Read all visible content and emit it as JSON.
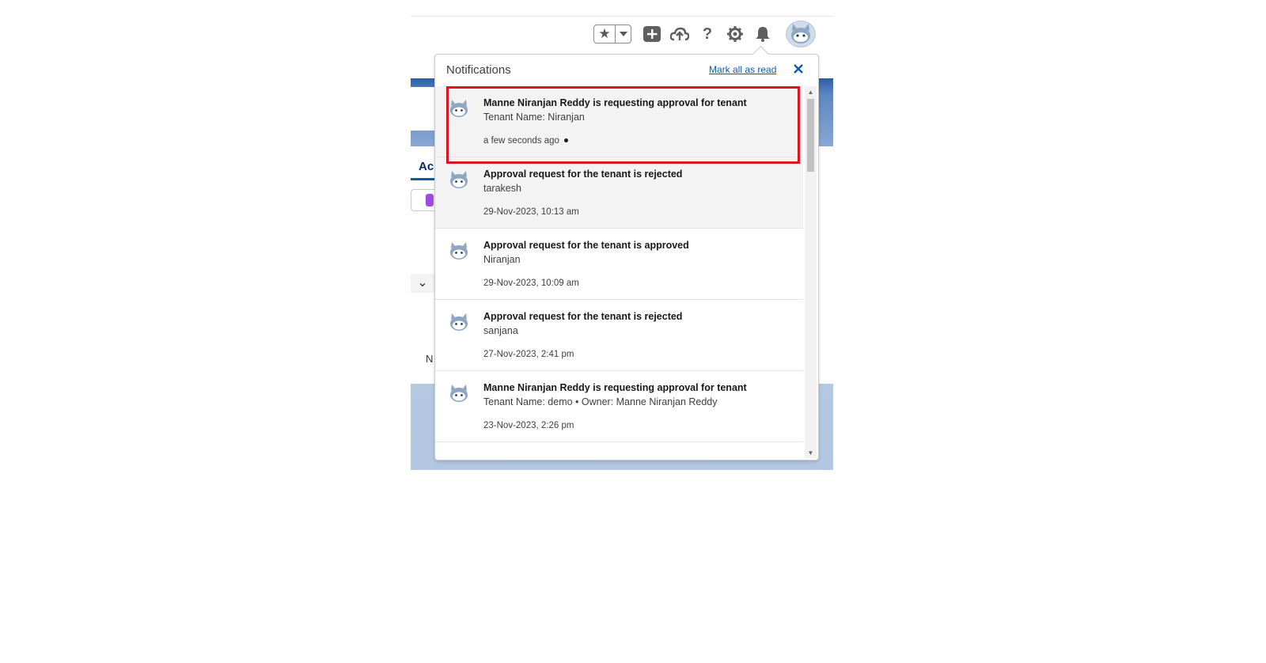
{
  "app": {
    "tab_hint": "Ac",
    "left_hint": "N",
    "chevron": "⌄"
  },
  "header": {
    "icons": [
      "star-icon",
      "chevron-down-icon",
      "add-icon",
      "cloud-upload-icon",
      "help-icon",
      "gear-icon",
      "bell-icon",
      "avatar"
    ]
  },
  "notifications": {
    "title": "Notifications",
    "mark_all_label": "Mark all as read",
    "close_label": "✕",
    "items": [
      {
        "title": "Manne Niranjan Reddy is requesting approval for tenant",
        "subtitle": "Tenant Name: Niranjan",
        "time": "a few seconds ago",
        "unread": true,
        "highlighted": true
      },
      {
        "title": "Approval request for the tenant is rejected",
        "subtitle": "tarakesh",
        "time": "29-Nov-2023, 10:13 am",
        "unread": true
      },
      {
        "title": "Approval request for the tenant is approved",
        "subtitle": "Niranjan",
        "time": "29-Nov-2023, 10:09 am",
        "unread": false
      },
      {
        "title": "Approval request for the tenant is rejected",
        "subtitle": "sanjana",
        "time": "27-Nov-2023, 2:41 pm",
        "unread": false
      },
      {
        "title": "Manne Niranjan Reddy is requesting approval for tenant",
        "subtitle": "Tenant Name: demo • Owner: Manne Niranjan Reddy",
        "time": "23-Nov-2023, 2:26 pm",
        "unread": false
      }
    ]
  },
  "colors": {
    "highlight": "#e0141e",
    "link": "#0b5cab",
    "unread_bg": "#f3f3f3"
  }
}
